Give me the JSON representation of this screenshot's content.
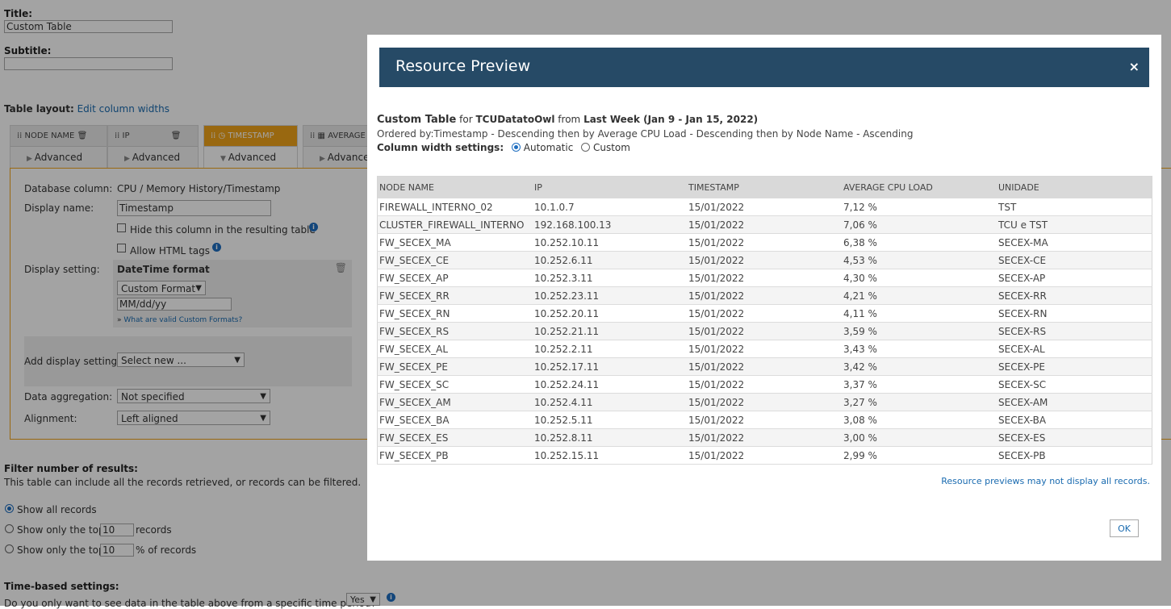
{
  "form": {
    "title_label": "Title:",
    "title_value": "Custom Table",
    "subtitle_label": "Subtitle:",
    "subtitle_value": "",
    "table_layout_label": "Table layout:",
    "edit_column_widths": "Edit column widths",
    "tabs": [
      {
        "name": "NODE NAME",
        "advanced": "Advanced"
      },
      {
        "name": "IP",
        "advanced": "Advanced"
      },
      {
        "name": "TIMESTAMP",
        "advanced": "Advanced"
      },
      {
        "name": "AVERAGE",
        "advanced": "Advanced"
      }
    ],
    "db_column_label": "Database column:",
    "db_column_value": "CPU / Memory History/Timestamp",
    "display_name_label": "Display name:",
    "display_name_value": "Timestamp",
    "hide_column_label": "Hide this column in the resulting table",
    "allow_html_label": "Allow HTML tags",
    "display_setting_label": "Display setting:",
    "datetime_format_label": "DateTime format",
    "format_select": "Custom Format",
    "format_value": "MM/dd/yy",
    "valid_formats_link": "What are valid Custom Formats?",
    "add_display_label": "Add display settings:",
    "add_display_select": "Select new ...",
    "aggregation_label": "Data aggregation:",
    "aggregation_value": "Not specified",
    "alignment_label": "Alignment:",
    "alignment_value": "Left aligned",
    "filter_heading": "Filter number of results:",
    "filter_desc": "This table can include all the records retrieved, or records can be filtered.",
    "show_all": "Show all records",
    "show_top": "Show only the top",
    "top_value": "10",
    "records": "records",
    "percent_records": "% of records",
    "time_heading": "Time-based settings:",
    "time_question": "Do you only want to see data in the table above from a specific time period?",
    "time_select": "Yes"
  },
  "modal": {
    "title": "Resource Preview",
    "close": "×",
    "table_name": "Custom Table",
    "for_text": "for",
    "node": "TCUDatatoOwl",
    "from_text": "from",
    "period": "Last Week (Jan 9 - Jan 15, 2022)",
    "ordered_by": "Ordered by:Timestamp - Descending then by Average CPU Load - Descending then by Node Name - Ascending",
    "col_width_label": "Column width settings:",
    "automatic": "Automatic",
    "custom": "Custom",
    "note": "Resource previews may not display all records.",
    "ok": "OK",
    "columns": [
      "NODE NAME",
      "IP",
      "TIMESTAMP",
      "AVERAGE CPU LOAD",
      "UNIDADE"
    ],
    "rows": [
      [
        "FIREWALL_INTERNO_02",
        "10.1.0.7",
        "15/01/2022",
        "7,12 %",
        "TST"
      ],
      [
        "CLUSTER_FIREWALL_INTERNO",
        "192.168.100.13",
        "15/01/2022",
        "7,06 %",
        "TCU e TST"
      ],
      [
        "FW_SECEX_MA",
        "10.252.10.11",
        "15/01/2022",
        "6,38 %",
        "SECEX-MA"
      ],
      [
        "FW_SECEX_CE",
        "10.252.6.11",
        "15/01/2022",
        "4,53 %",
        "SECEX-CE"
      ],
      [
        "FW_SECEX_AP",
        "10.252.3.11",
        "15/01/2022",
        "4,30 %",
        "SECEX-AP"
      ],
      [
        "FW_SECEX_RR",
        "10.252.23.11",
        "15/01/2022",
        "4,21 %",
        "SECEX-RR"
      ],
      [
        "FW_SECEX_RN",
        "10.252.20.11",
        "15/01/2022",
        "4,11 %",
        "SECEX-RN"
      ],
      [
        "FW_SECEX_RS",
        "10.252.21.11",
        "15/01/2022",
        "3,59 %",
        "SECEX-RS"
      ],
      [
        "FW_SECEX_AL",
        "10.252.2.11",
        "15/01/2022",
        "3,43 %",
        "SECEX-AL"
      ],
      [
        "FW_SECEX_PE",
        "10.252.17.11",
        "15/01/2022",
        "3,42 %",
        "SECEX-PE"
      ],
      [
        "FW_SECEX_SC",
        "10.252.24.11",
        "15/01/2022",
        "3,37 %",
        "SECEX-SC"
      ],
      [
        "FW_SECEX_AM",
        "10.252.4.11",
        "15/01/2022",
        "3,27 %",
        "SECEX-AM"
      ],
      [
        "FW_SECEX_BA",
        "10.252.5.11",
        "15/01/2022",
        "3,08 %",
        "SECEX-BA"
      ],
      [
        "FW_SECEX_ES",
        "10.252.8.11",
        "15/01/2022",
        "3,00 %",
        "SECEX-ES"
      ],
      [
        "FW_SECEX_PB",
        "10.252.15.11",
        "15/01/2022",
        "2,99 %",
        "SECEX-PB"
      ]
    ]
  }
}
